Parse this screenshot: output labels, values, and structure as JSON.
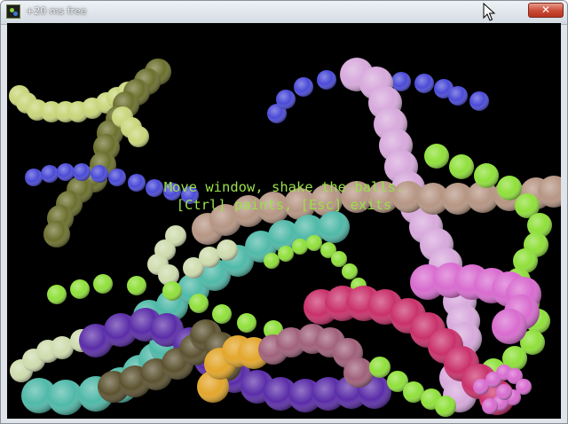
{
  "window": {
    "title": "+20 ms free",
    "close_glyph": "✕"
  },
  "overlay": {
    "line1": "Move window, shake the balls.",
    "line2": "[Ctrl] paints, [Esc] exits"
  },
  "colors": {
    "background": "#000000",
    "text": "#9be04a",
    "yellow_green": "#c9d67a",
    "olive": "#6b6f2c",
    "blue": "#4a4ad8",
    "lavender": "#d7a9dc",
    "tan": "#b69583",
    "lime": "#8fe03a",
    "teal": "#4fb9a8",
    "pale": "#cfdcae",
    "magenta_rose": "#c9306a",
    "pink": "#d86bcf",
    "purple": "#5a2ca8",
    "dark_olive": "#5c5230",
    "gold": "#e3a62a",
    "mauve": "#a0607a"
  }
}
